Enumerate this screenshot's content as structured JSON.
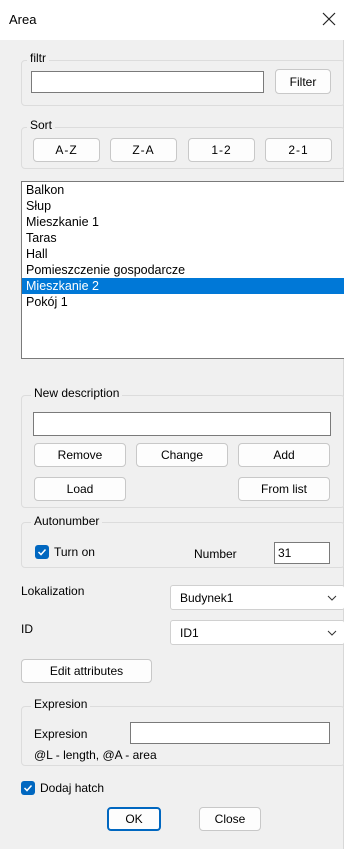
{
  "window": {
    "title": "Area"
  },
  "filter_group": {
    "label": "filtr",
    "value": "",
    "button": "Filter"
  },
  "sort_group": {
    "label": "Sort",
    "buttons": [
      "A-Z",
      "Z-A",
      "1-2",
      "2-1"
    ]
  },
  "list": {
    "items": [
      "Balkon",
      "Słup",
      "Mieszkanie 1",
      "Taras",
      "Hall",
      "Pomieszczenie gospodarcze",
      "Mieszkanie 2",
      "Pokój 1"
    ],
    "selected": "Mieszkanie 2"
  },
  "description_group": {
    "label": "New description",
    "value": "",
    "remove": "Remove",
    "change": "Change",
    "add": "Add",
    "load": "Load",
    "from_list": "From list"
  },
  "autonumber_group": {
    "label": "Autonumber",
    "turn_on": "Turn on",
    "turn_on_checked": true,
    "number_label": "Number",
    "number_value": "31"
  },
  "lokalization": {
    "label": "Lokalization",
    "value": "Budynek1"
  },
  "id_field": {
    "label": "ID",
    "value": "ID1"
  },
  "edit_attributes": "Edit attributes",
  "expresion_group": {
    "label": "Expresion",
    "field_label": "Expresion",
    "value": "",
    "hint": "@L - length, @A - area"
  },
  "hatch": {
    "label": "Dodaj hatch",
    "checked": true
  },
  "footer": {
    "ok": "OK",
    "close": "Close"
  },
  "colors": {
    "selection": "#0078d7",
    "checkbox": "#0067c0"
  }
}
